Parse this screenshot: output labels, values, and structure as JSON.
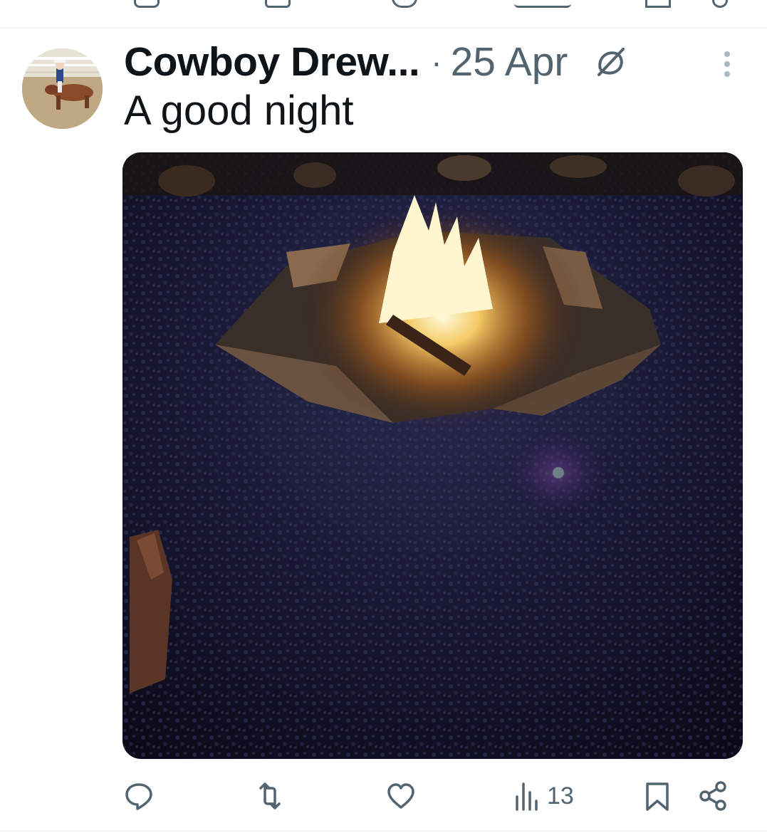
{
  "tweet": {
    "author_name": "Cowboy Drew...",
    "separator": "·",
    "date": "25 Apr",
    "text": "A good night",
    "avatar_icon": "avatar-cowboy-on-horse",
    "media_description_icon": "fire-pit-photo"
  },
  "actions": {
    "reply_icon": "reply-icon",
    "retweet_icon": "retweet-icon",
    "like_icon": "heart-icon",
    "views_icon": "views-icon",
    "views_count": "13",
    "bookmark_icon": "bookmark-icon",
    "share_icon": "share-icon"
  },
  "colors": {
    "text_primary": "#0f1419",
    "text_secondary": "#536471",
    "divider": "#eff3f4"
  }
}
